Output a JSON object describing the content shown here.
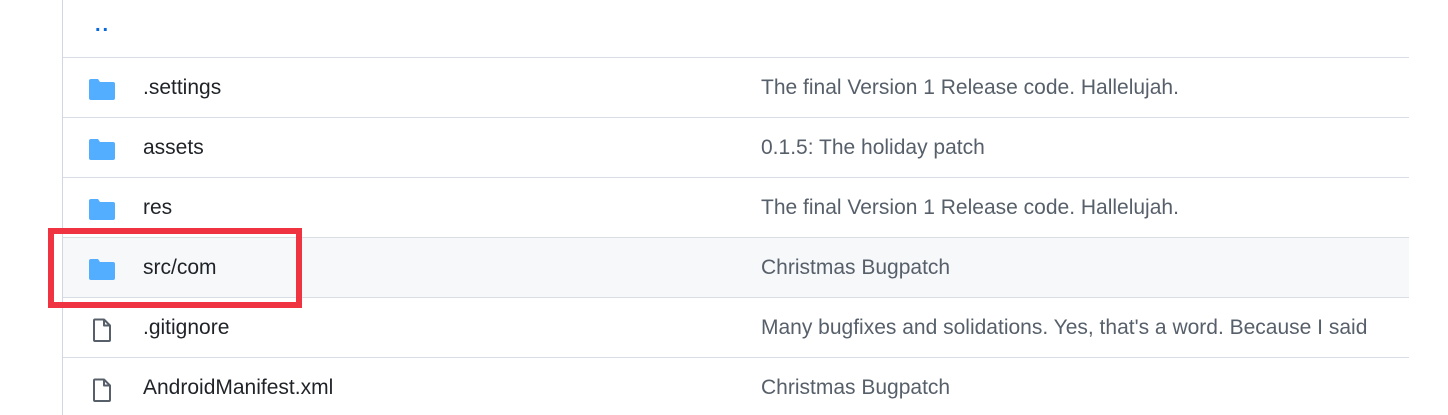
{
  "file_list": {
    "parent_link": "..",
    "rows": [
      {
        "name": ".settings",
        "type": "folder",
        "commit": "The final Version 1 Release code. Hallelujah."
      },
      {
        "name": "assets",
        "type": "folder",
        "commit": "0.1.5: The holiday patch"
      },
      {
        "name": "res",
        "type": "folder",
        "commit": "The final Version 1 Release code. Hallelujah."
      },
      {
        "name": "src/com",
        "type": "folder",
        "commit": "Christmas Bugpatch"
      },
      {
        "name": ".gitignore",
        "type": "file",
        "commit": "Many bugfixes and solidations. Yes, that's a word. Because I said"
      },
      {
        "name": "AndroidManifest.xml",
        "type": "file",
        "commit": "Christmas Bugpatch"
      }
    ]
  },
  "colors": {
    "folder_icon": "#54aeff",
    "file_icon": "#57606a",
    "link": "#0969da",
    "annotation_box": "#ef3340",
    "row_highlight": "#f6f8fa"
  },
  "icons": {
    "folder": "folder-icon",
    "file": "file-icon"
  },
  "annotation": {
    "target_row": "src/com"
  }
}
